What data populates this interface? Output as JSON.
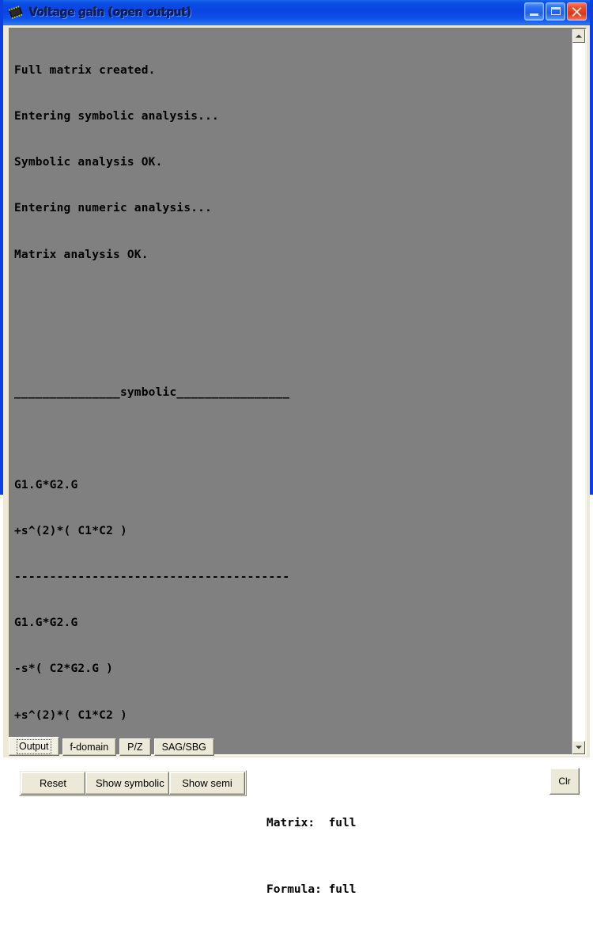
{
  "window": {
    "title": "Voltage gain (open output)",
    "icon": "chip-icon",
    "controls": {
      "minimize": "Minimize",
      "maximize": "Maximize",
      "close": "Close"
    },
    "colors": {
      "titlebar_blue": "#0A44E2",
      "close_red": "#D8381A",
      "client_beige": "#ECE9D8",
      "output_gray": "#808080",
      "text_black": "#000000"
    }
  },
  "output": {
    "lines": [
      "Full matrix created.",
      "Entering symbolic analysis...",
      "Symbolic analysis OK.",
      "Entering numeric analysis...",
      "Matrix analysis OK.",
      "",
      "",
      "_______________symbolic________________",
      "",
      "G1.G*G2.G",
      "+s^(2)*( C1*C2 )",
      "---------------------------------------",
      "G1.G*G2.G",
      "-s*( C2*G2.G )",
      "+s^(2)*( C1*C2 )"
    ],
    "section_header": "symbolic",
    "numerator": [
      "G1.G*G2.G",
      "+s^(2)*( C1*C2 )"
    ],
    "denominator": [
      "G1.G*G2.G",
      "-s*( C2*G2.G )",
      "+s^(2)*( C1*C2 )"
    ],
    "log_messages": [
      "Full matrix created.",
      "Entering symbolic analysis...",
      "Symbolic analysis OK.",
      "Entering numeric analysis...",
      "Matrix analysis OK."
    ]
  },
  "scrollbar": {
    "up_arrow": "scroll-up-icon",
    "down_arrow": "scroll-down-icon"
  },
  "controls": {
    "reset": "Reset",
    "show_symbolic": "Show symbolic",
    "show_semi": "Show semi",
    "clear": "Clr"
  },
  "status": {
    "matrix_line": "Matrix:  full",
    "formula_line": "Formula: full",
    "matrix_label": "Matrix:",
    "matrix_value": "full",
    "formula_label": "Formula:",
    "formula_value": "full"
  },
  "tabs": [
    {
      "label": "Output",
      "selected": true
    },
    {
      "label": "f-domain",
      "selected": false
    },
    {
      "label": "P/Z",
      "selected": false
    },
    {
      "label": "SAG/SBG",
      "selected": false
    }
  ]
}
